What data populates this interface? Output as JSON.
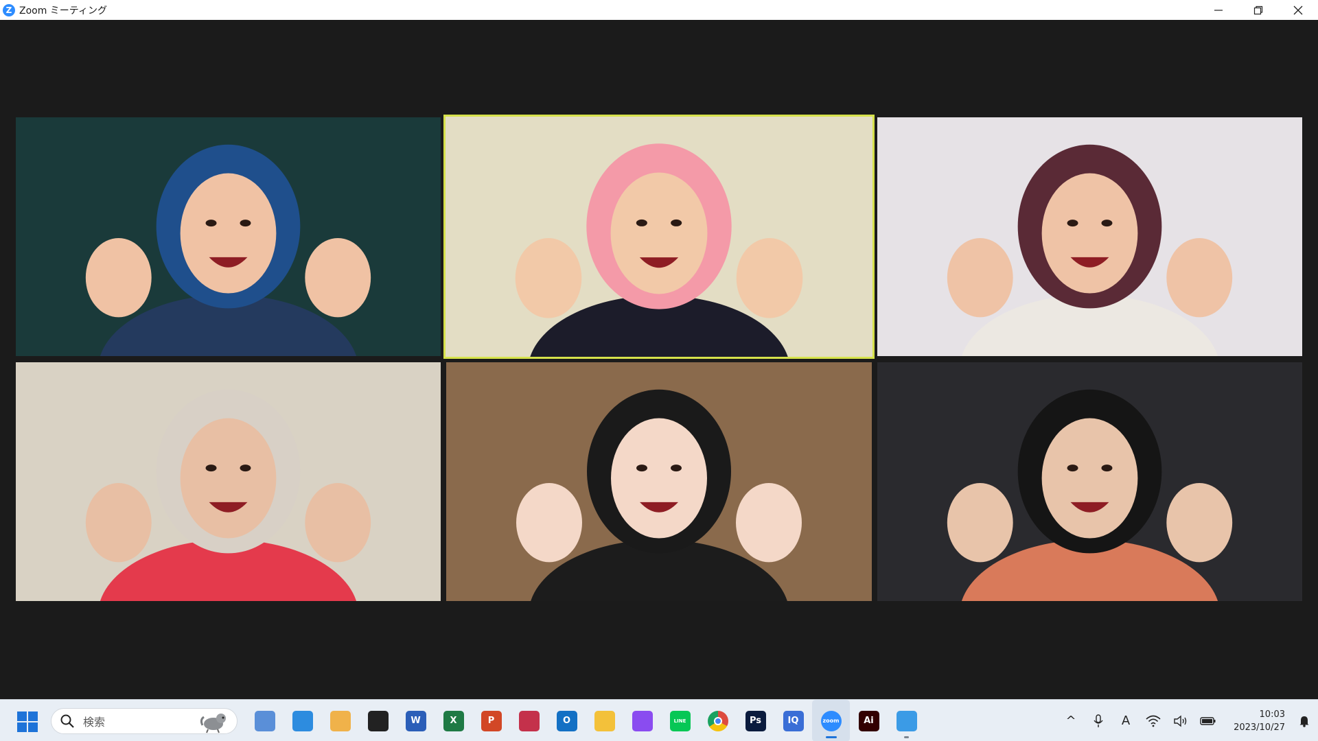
{
  "window": {
    "logo_letter": "Z",
    "title": "Zoom ミーティング"
  },
  "taskbar": {
    "search_placeholder": "検索",
    "apps": [
      {
        "name": "photos-app-icon",
        "label": "",
        "color": "#5a8fd8"
      },
      {
        "name": "paint-app-icon",
        "label": "",
        "color": "#2d8cdf"
      },
      {
        "name": "notepad-app-icon",
        "label": "",
        "color": "#f0b24a"
      },
      {
        "name": "sticky-notes-icon",
        "label": "",
        "color": "#222222"
      },
      {
        "name": "word-icon",
        "label": "W",
        "color": "#2b5eb8"
      },
      {
        "name": "excel-icon",
        "label": "X",
        "color": "#1f7a45"
      },
      {
        "name": "powerpoint-icon",
        "label": "P",
        "color": "#d24726"
      },
      {
        "name": "snipping-tool-icon",
        "label": "",
        "color": "#c4314b"
      },
      {
        "name": "outlook-icon",
        "label": "O",
        "color": "#1370c4"
      },
      {
        "name": "file-explorer-icon",
        "label": "",
        "color": "#f3c13a"
      },
      {
        "name": "messenger-icon",
        "label": "",
        "color": "#8a4cf0"
      },
      {
        "name": "line-icon",
        "label": "LINE",
        "color": "#06c755"
      },
      {
        "name": "chrome-icon",
        "label": "",
        "color": "#dd4b3e"
      },
      {
        "name": "photoshop-icon",
        "label": "Ps",
        "color": "#0a1b3d"
      },
      {
        "name": "iq-app-icon",
        "label": "IQ",
        "color": "#3a6ed6"
      },
      {
        "name": "zoom-icon",
        "label": "zoom",
        "color": "#2d8cff"
      },
      {
        "name": "illustrator-icon",
        "label": "Ai",
        "color": "#330000"
      },
      {
        "name": "image-viewer-icon",
        "label": "",
        "color": "#3b9be6"
      }
    ],
    "tray": {
      "chevron": "^",
      "mic": "🎙",
      "ime": "A",
      "time": "10:03",
      "date": "2023/10/27"
    }
  },
  "meeting": {
    "active_speaker_color": "#d6e24b",
    "tiles": [
      {
        "name": "participant-tile-1",
        "bg": "#1a3a3a",
        "hair": "#1f4f8c",
        "skin": "#f0c2a4",
        "top": "#243a5e"
      },
      {
        "name": "participant-tile-2",
        "bg": "#e3ddc4",
        "hair": "#f49aa8",
        "skin": "#f2c9a8",
        "top": "#1c1c2a"
      },
      {
        "name": "participant-tile-3",
        "bg": "#e6e2e6",
        "hair": "#5a2a36",
        "skin": "#efc3a6",
        "top": "#ece8e2"
      },
      {
        "name": "participant-tile-4",
        "bg": "#d9d2c4",
        "hair": "#d8d0c6",
        "skin": "#e8bfa4",
        "top": "#e43a4c"
      },
      {
        "name": "participant-tile-5",
        "bg": "#8a6a4c",
        "hair": "#1a1a1a",
        "skin": "#f4d8c8",
        "top": "#1c1c1c"
      },
      {
        "name": "participant-tile-6",
        "bg": "#2a2a2e",
        "hair": "#151515",
        "skin": "#e8c4aa",
        "top": "#d97a5a"
      }
    ]
  }
}
